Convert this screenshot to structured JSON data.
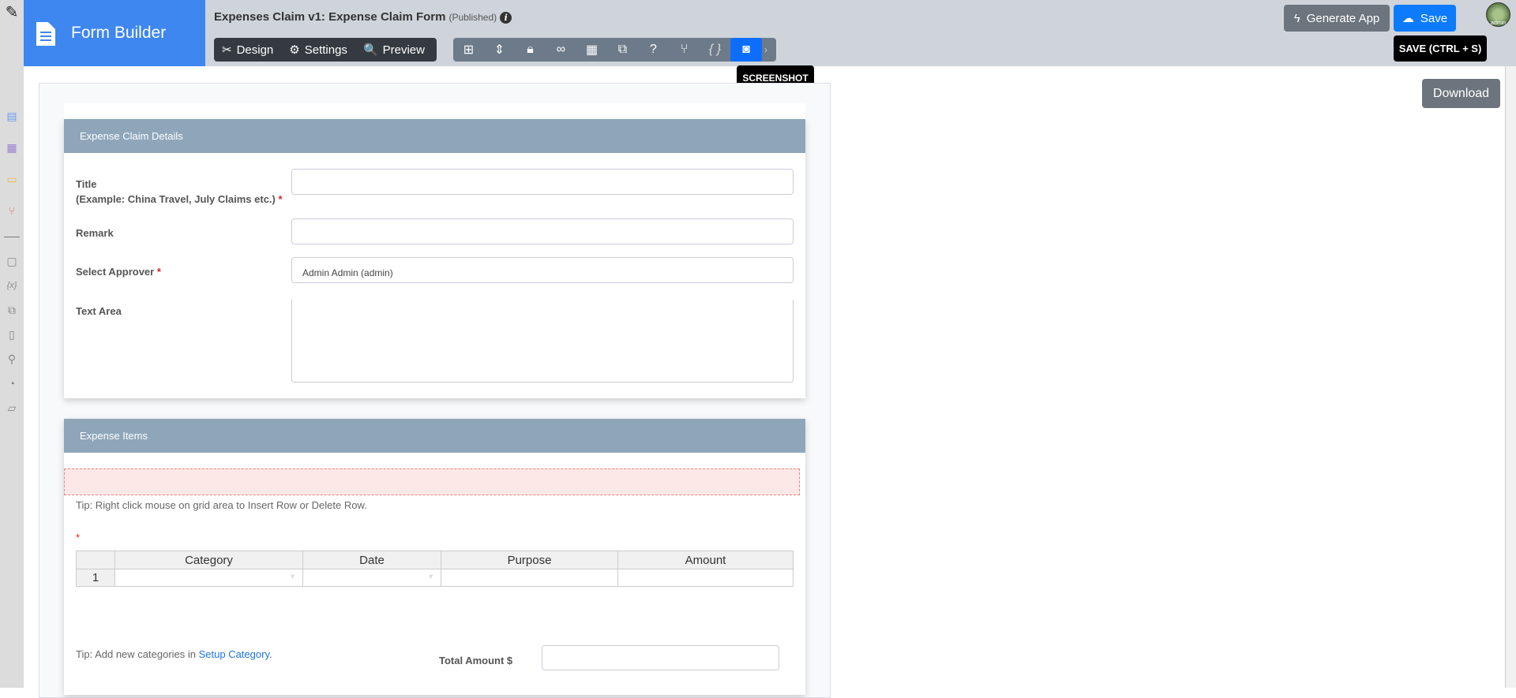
{
  "app": {
    "name": "Form Builder"
  },
  "header": {
    "title": "Expenses Claim v1: Expense Claim Form",
    "status": "(Published)"
  },
  "modes": [
    {
      "label": "Design"
    },
    {
      "label": "Settings"
    },
    {
      "label": "Preview"
    }
  ],
  "toolbar": {
    "icons": [
      "sitemap-icon",
      "import-export-icon",
      "lock-icon",
      "binoculars-icon",
      "grid-icon",
      "translate-icon",
      "help-icon",
      "branch-icon",
      "code-braces-icon",
      "camera-icon"
    ],
    "tooltip": "SCREENSHOT"
  },
  "actions": {
    "generate": "Generate App",
    "save": "Save",
    "save_tooltip": "SAVE (CTRL + S)",
    "download": "Download",
    "avatar_text": "admin"
  },
  "sections": [
    {
      "title": "Expense Claim Details",
      "fields": {
        "title_label": "Title",
        "title_hint": "(Example: China Travel, July Claims etc.)",
        "remark_label": "Remark",
        "approver_label": "Select Approver",
        "approver_value": "Admin Admin (admin)",
        "textarea_label": "Text Area"
      }
    },
    {
      "title": "Expense Items",
      "tip_grid": "Tip: Right click mouse on grid area to Insert Row or Delete Row.",
      "columns": [
        "Category",
        "Date",
        "Purpose",
        "Amount"
      ],
      "rows": [
        {
          "num": "1"
        }
      ],
      "tip_category": "Tip: Add new categories in ",
      "tip_link": "Setup Category",
      "tip_end": ".",
      "total_label": "Total Amount $"
    }
  ],
  "required_mark": "*",
  "colors": {
    "brand": "#3e86f0",
    "section_header": "#8fa6ba",
    "save": "#0d7bfd"
  }
}
